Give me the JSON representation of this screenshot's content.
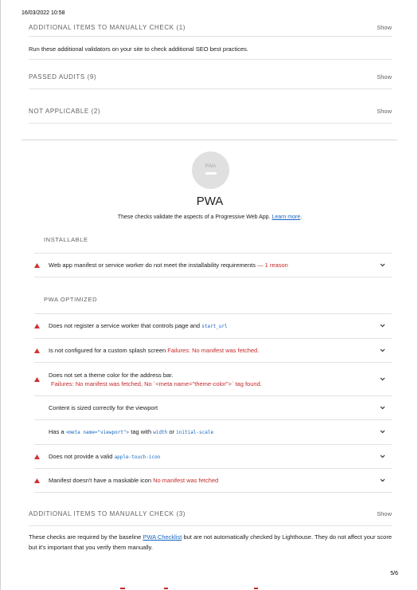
{
  "print_date": "16/03/2022 10:58",
  "seo": {
    "manual": {
      "title": "ADDITIONAL ITEMS TO MANUALLY CHECK (1)",
      "show": "Show",
      "description": "Run these additional validators on your site to check additional SEO best practices."
    },
    "passed": {
      "title": "PASSED AUDITS (9)",
      "show": "Show"
    },
    "not_applicable": {
      "title": "NOT APPLICABLE (2)",
      "show": "Show"
    }
  },
  "pwa": {
    "gauge_label": "PWA",
    "title": "PWA",
    "subtitle": "These checks validate the aspects of a Progressive Web App.",
    "learn_more": "Learn more",
    "subtitle_end": ".",
    "installable": {
      "title": "INSTALLABLE",
      "audits": [
        {
          "text": "Web app manifest or service worker do not meet the installability requirements",
          "extra": "— 1 reason"
        }
      ]
    },
    "optimized": {
      "title": "PWA OPTIMIZED",
      "audits": [
        {
          "text": "Does not register a service worker that controls page and",
          "code": "start_url"
        },
        {
          "text": "Is not configured for a custom splash screen",
          "extra": "Failures: No manifest was fetched."
        },
        {
          "text": "Does not set a theme color for the address bar.",
          "extra": "Failures: No manifest was fetched, No `<meta name=\"theme-color\">` tag found."
        },
        {
          "text": "Content is sized correctly for the viewport"
        },
        {
          "text_a": "Has a",
          "code_a": "<meta name=\"viewport\">",
          "text_b": "tag with",
          "code_b": "width",
          "text_c": "or",
          "code_c": "initial-scale"
        },
        {
          "text": "Does not provide a valid",
          "code": "apple-touch-icon"
        },
        {
          "text": "Manifest doesn't have a maskable icon",
          "extra": "No manifest was fetched"
        }
      ]
    },
    "manual": {
      "title": "ADDITIONAL ITEMS TO MANUALLY CHECK (3)",
      "show": "Show",
      "desc_a": "These checks are required by the baseline",
      "desc_link": "PWA Checklist",
      "desc_b": "but are not automatically checked by Lighthouse. They do not affect your score but it's important that you verify them manually."
    }
  },
  "page_number": "5/6",
  "colors": {
    "fail": "#c62828",
    "link": "#1565c0",
    "muted": "#616161"
  }
}
